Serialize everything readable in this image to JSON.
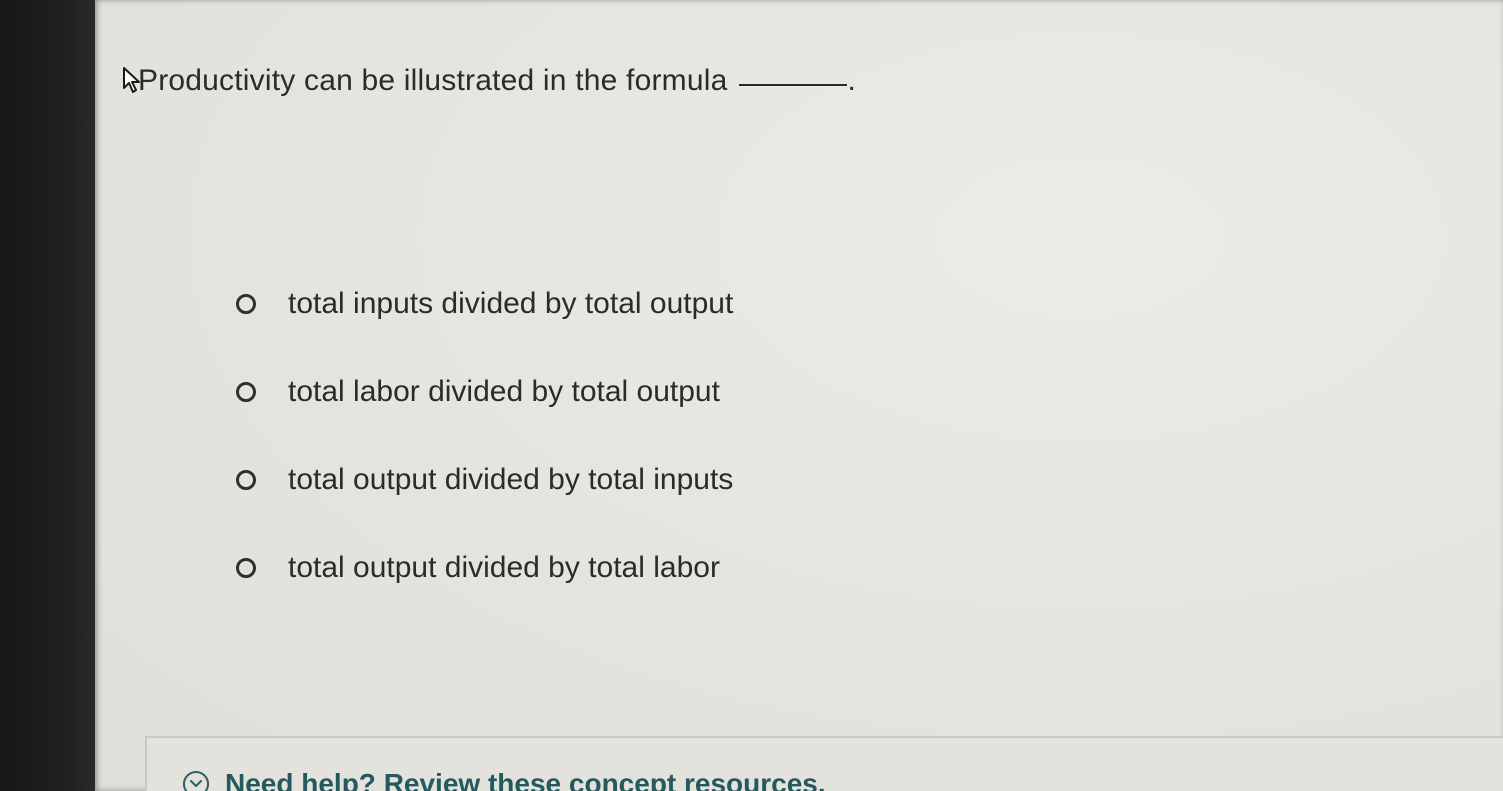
{
  "question": {
    "text": "Productivity can be illustrated in the formula",
    "end_punct": "."
  },
  "options": [
    {
      "label": "total inputs divided by total output",
      "selected": false
    },
    {
      "label": "total labor divided by total output",
      "selected": false
    },
    {
      "label": "total output divided by total inputs",
      "selected": false
    },
    {
      "label": "total output divided by total labor",
      "selected": false
    }
  ],
  "help": {
    "label": "Need help? Review these concept resources.",
    "icon": "chevron-down-icon"
  },
  "colors": {
    "help_text": "#245a5e",
    "page_background": "#e6e5df"
  }
}
